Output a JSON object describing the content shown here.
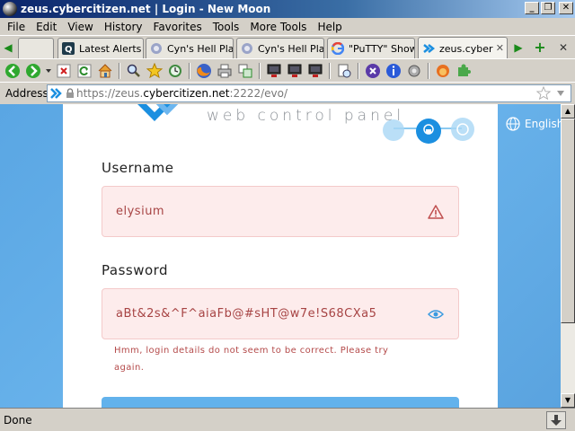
{
  "window": {
    "title": "zeus.cybercitizen.net | Login - New Moon",
    "minimize": "_",
    "restore": "❐",
    "close": "✕"
  },
  "menu": [
    "File",
    "Edit",
    "View",
    "History",
    "Favorites",
    "Tools",
    "More Tools",
    "Help"
  ],
  "tabs": [
    {
      "label": "Latest Alerts |",
      "icon": "q-favicon"
    },
    {
      "label": "Cyn's Hell Plan",
      "icon": "page-favicon"
    },
    {
      "label": "Cyn's Hell Plan",
      "icon": "page-favicon"
    },
    {
      "label": "\"PuTTY\" Show",
      "icon": "google-favicon"
    },
    {
      "label": "zeus.cyber",
      "icon": "zeus-favicon",
      "active": true
    }
  ],
  "address": {
    "label": "Address",
    "url_prefix": "https://zeus.",
    "url_domain": "cybercitizen.net",
    "url_suffix": ":2222/evo/"
  },
  "page": {
    "logo_text": "web control panel",
    "language": "English",
    "username_label": "Username",
    "username_value": "elysium",
    "password_label": "Password",
    "password_value": "aBt&2s&^F^aiaFb@#sHT@w7e!S68CXa5",
    "error_message": "Hmm, login details do not seem to be correct. Please try again."
  },
  "status": {
    "text": "Done"
  },
  "colors": {
    "accent": "#1b8fe0",
    "error": "#b44a4a",
    "input_error_bg": "#fdecec",
    "page_bg": "#5aa6e3"
  }
}
